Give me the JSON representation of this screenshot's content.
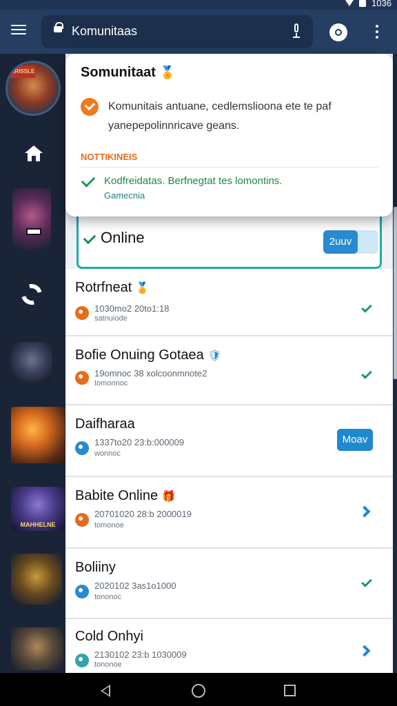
{
  "status_bar": {
    "time": "1036"
  },
  "browser": {
    "url": "Komunitaas"
  },
  "popup": {
    "title": "Somunitaat",
    "title_badge": "🏅",
    "description_line1": "Komunitais antuane, cedlemslioona ete te paf",
    "description_line2": "yanepepolinnricave geans.",
    "section_label": "NOTTIKINEIS",
    "notification_line1": "Kodfreidatas. Berfnegtat tes lomontins.",
    "notification_line2": "Gamecnia"
  },
  "online_card": {
    "label": "Online",
    "button": "2uuv"
  },
  "list": [
    {
      "title": "Rotrfneat",
      "badge": "🏅",
      "meta1": "1030mo2 20to1:18",
      "meta2": "satnuiode",
      "icon": "orange",
      "action": "check"
    },
    {
      "title": "Bofie Onuing Gotaea",
      "badge": "🛡",
      "meta1": "19omnoc 38 xolcoonmnote2",
      "meta2": "tomonnoc",
      "icon": "orange",
      "action": "check"
    },
    {
      "title": "Daifharaa",
      "badge": "",
      "meta1": "1337to20 23:b:000009",
      "meta2": "wonnoc",
      "icon": "blue",
      "action": "button",
      "button": "Moav"
    },
    {
      "title": "Babite Online",
      "badge": "🎁",
      "meta1": "20701020 28:b 2000019",
      "meta2": "tomonoe",
      "icon": "orange",
      "action": "arrow"
    },
    {
      "title": "Boliiny",
      "badge": "",
      "meta1": "2020102 3as1o1000",
      "meta2": "tononoc",
      "icon": "blue",
      "action": "check"
    },
    {
      "title": "Cold Onhyi",
      "badge": "",
      "meta1": "2130102 23:b 1030009",
      "meta2": "tononoe",
      "icon": "teal",
      "action": "arrow"
    }
  ],
  "sidebar": {
    "avatar_badge": "KRISSLE",
    "game_4_title": "MAHHELNE"
  }
}
